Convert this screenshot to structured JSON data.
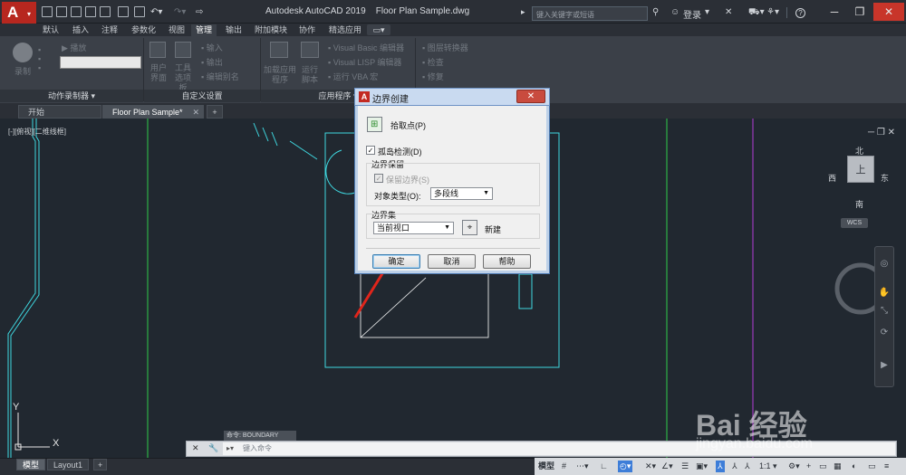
{
  "app": {
    "title": "Autodesk AutoCAD 2019",
    "filename": "Floor Plan Sample.dwg",
    "logo_letter": "A",
    "search_placeholder": "键入关键字或短语",
    "login_label": "登录",
    "help_label": "?"
  },
  "ribbon": {
    "tabs": [
      "默认",
      "插入",
      "注释",
      "参数化",
      "视图",
      "管理",
      "输出",
      "附加模块",
      "协作",
      "精选应用"
    ],
    "active_tab": "管理",
    "groups": [
      {
        "title": "动作录制器 ▾",
        "items": [
          "录制",
          "播放"
        ]
      },
      {
        "title": "自定义设置",
        "items": [
          "用户界面",
          "工具选项板",
          "输入",
          "输出",
          "编辑别名"
        ]
      },
      {
        "title": "应用程序",
        "items": [
          "加载应用程序",
          "运行脚本",
          "Visual Basic 编辑器",
          "Visual LISP 编辑器",
          "运行 VBA 宏"
        ]
      },
      {
        "title": "",
        "items": [
          "图层转换器",
          "检查",
          "修复"
        ]
      }
    ]
  },
  "doc_tabs": {
    "items": [
      "开始",
      "Floor Plan Sample*"
    ],
    "active": "Floor Plan Sample*",
    "add": "+"
  },
  "viewport": {
    "label": "[-][俯视][二维线框]",
    "compass": {
      "north": "北",
      "south": "南",
      "east": "东",
      "west": "西",
      "top": "上"
    },
    "wcs": "WCS",
    "axis_x": "X",
    "axis_y": "Y"
  },
  "dialog": {
    "title": "边界创建",
    "pick_points": "拾取点(P)",
    "island_detection": "孤岛检测(D)",
    "island_checked": true,
    "retention_group": "边界保留",
    "retain_boundaries": "保留边界(S)",
    "retain_checked": true,
    "object_type_label": "对象类型(O):",
    "object_type_value": "多段线",
    "boundary_set_group": "边界集",
    "boundary_set_value": "当前视口",
    "new_label": "新建",
    "ok": "确定",
    "cancel": "取消",
    "help": "帮助"
  },
  "command": {
    "history": "命令: BOUNDARY",
    "placeholder": "键入命令"
  },
  "statusbar": {
    "layout_tabs": [
      "模型",
      "Layout1"
    ],
    "active_layout": "模型",
    "add": "+",
    "model_label": "模型",
    "scale": "1:1"
  },
  "watermark": {
    "line1": "Bai 经验",
    "line2": "jingyan.baidu.com"
  },
  "colors": {
    "canvas_bg": "#212830",
    "line_cyan": "#3fd8e0",
    "line_green": "#2ecc4a",
    "line_magenta": "#b43bd6",
    "arrow_red": "#e0251b",
    "title_red": "#c32a23"
  }
}
